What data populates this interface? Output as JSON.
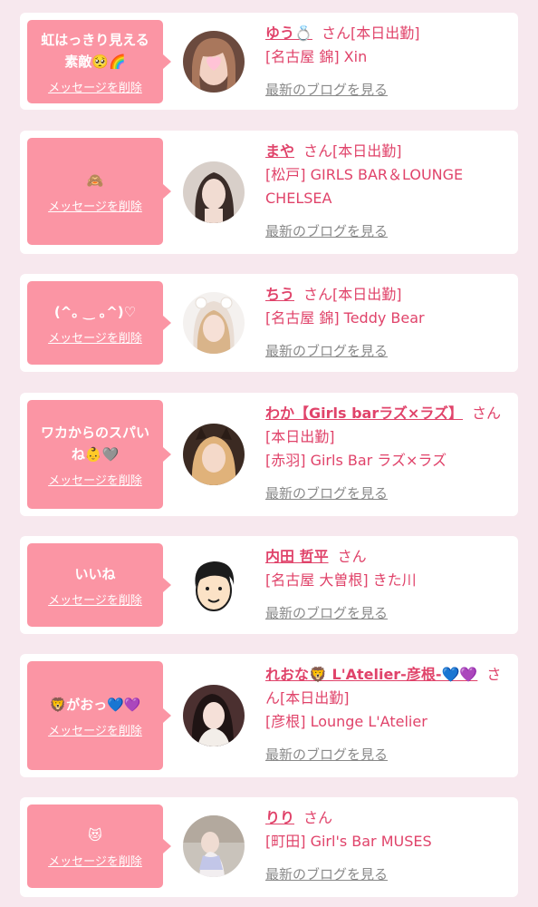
{
  "common": {
    "delete_label": "メッセージを削除",
    "blog_label": "最新のブログを見る",
    "san_label": "さん"
  },
  "colors": {
    "background": "#f7e8ee",
    "bubble": "#fb95a4",
    "accent": "#e0436a",
    "link_gray": "#8a8a8a"
  },
  "items": [
    {
      "message": "虹はっきり見える素敵🥺🌈",
      "name": "ゆう💍",
      "status": "[本日出勤]",
      "shop": "[名古屋 錦] Xin"
    },
    {
      "message": "🙈",
      "name": "まや",
      "status": "[本日出勤]",
      "shop": "[松戸] GIRLS BAR＆LOUNGE CHELSEA"
    },
    {
      "message": "(^｡ ‿ ｡^)♡",
      "name": "ちう",
      "status": "[本日出勤]",
      "shop": "[名古屋 錦] Teddy Bear"
    },
    {
      "message": "ワカからのスパいね👶🩶",
      "name": "わか【Girls barラズ×ラズ】",
      "status": "[本日出勤]",
      "shop": "[赤羽] Girls Bar ラズ×ラズ"
    },
    {
      "message": "いいね",
      "name": "内田 哲平",
      "status": "",
      "shop": "[名古屋 大曽根] きた川"
    },
    {
      "message": "🦁がおっ💙💜",
      "name": "れおな🦁 L'Atelier-彦根-💙💜",
      "status": "[本日出勤]",
      "shop": "[彦根] Lounge L'Atelier"
    },
    {
      "message": "😻",
      "name": "りり",
      "status": "",
      "shop": "[町田] Girl's Bar MUSES"
    }
  ]
}
